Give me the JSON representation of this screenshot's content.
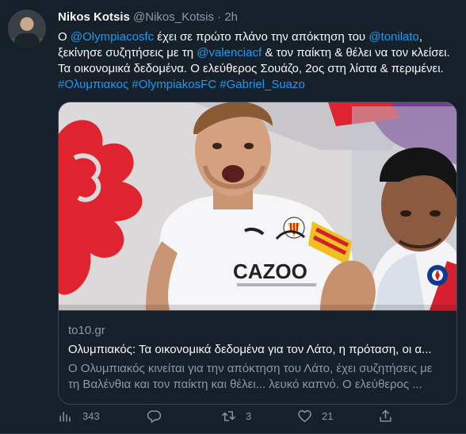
{
  "tweet": {
    "author_name": "Nikos Kotsis",
    "author_handle": "@Nikos_Kotsis",
    "separator": "·",
    "time": "2h",
    "text": {
      "l1_a": "Ο ",
      "l1_mention1": "@Olympiacosfc",
      "l1_b": " έχει σε πρώτο πλάνο την απόκτηση του ",
      "l1_mention2": "@tonilato",
      "l1_c": ",",
      "l2_a": "ξεκίνησε συζητήσεις με τη ",
      "l2_mention": "@valenciacf",
      "l2_b": " & τον παίκτη & θέλει να τον κλείσει.",
      "l3": "Τα οικονομικά δεδομένα. Ο ελεύθερος Σουάζο, 2ος στη λίστα & περιμένει.",
      "hashtag1": "#Ολυμπιακος",
      "hashtag2": "#OlympiakosFC",
      "hashtag3": "#Gabriel_Suazo"
    },
    "card": {
      "image_text_jersey": "CAZOO",
      "domain": "to10.gr",
      "title": "Ολυμπιακός: Τα οικονομικά δεδομένα για τον Λάτο, η πρόταση, οι α...",
      "desc_line1": "Ο Ολυμπιακός κινείται για την απόκτηση του Λάτο, έχει συζητήσεις με",
      "desc_line2": "τη Βαλένθια και τον παίκτη και θέλει... λευκό καπνό. Ο ελεύθερος ..."
    },
    "actions": {
      "views": "343",
      "replies": "",
      "retweets": "3",
      "likes": "21"
    }
  }
}
